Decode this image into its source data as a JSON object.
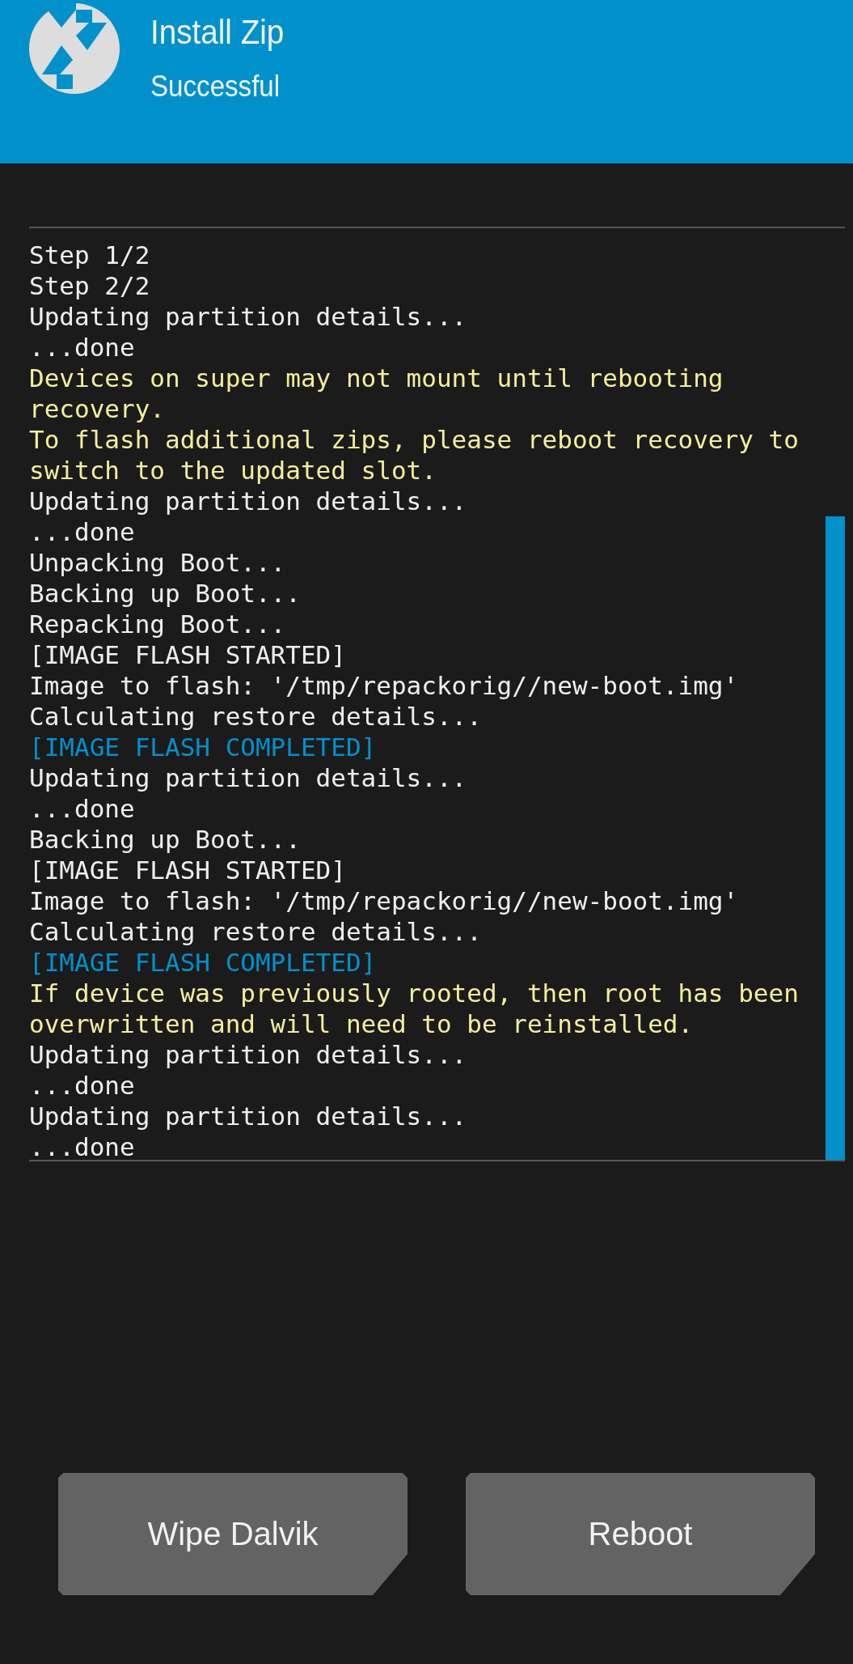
{
  "header": {
    "title": "Install Zip",
    "subtitle": "Successful"
  },
  "log": [
    {
      "kind": "normal",
      "text": "Step 1/2"
    },
    {
      "kind": "normal",
      "text": "Step 2/2"
    },
    {
      "kind": "normal",
      "text": "Updating partition details..."
    },
    {
      "kind": "normal",
      "text": "...done"
    },
    {
      "kind": "warning",
      "text": "Devices on super may not mount until rebooting recovery."
    },
    {
      "kind": "warning",
      "text": "To flash additional zips, please reboot recovery to switch to the updated slot."
    },
    {
      "kind": "normal",
      "text": "Updating partition details..."
    },
    {
      "kind": "normal",
      "text": "...done"
    },
    {
      "kind": "normal",
      "text": "Unpacking Boot..."
    },
    {
      "kind": "normal",
      "text": "Backing up Boot..."
    },
    {
      "kind": "normal",
      "text": "Repacking Boot..."
    },
    {
      "kind": "normal",
      "text": "[IMAGE FLASH STARTED]"
    },
    {
      "kind": "normal",
      "text": "Image to flash: '/tmp/repackorig//new-boot.img'"
    },
    {
      "kind": "normal",
      "text": "Calculating restore details..."
    },
    {
      "kind": "highlight",
      "text": "[IMAGE FLASH COMPLETED]"
    },
    {
      "kind": "normal",
      "text": "Updating partition details..."
    },
    {
      "kind": "normal",
      "text": "...done"
    },
    {
      "kind": "normal",
      "text": "Backing up Boot..."
    },
    {
      "kind": "normal",
      "text": "[IMAGE FLASH STARTED]"
    },
    {
      "kind": "normal",
      "text": "Image to flash: '/tmp/repackorig//new-boot.img'"
    },
    {
      "kind": "normal",
      "text": "Calculating restore details..."
    },
    {
      "kind": "highlight",
      "text": "[IMAGE FLASH COMPLETED]"
    },
    {
      "kind": "warning",
      "text": "If device was previously rooted, then root has been overwritten and will need to be reinstalled."
    },
    {
      "kind": "normal",
      "text": "Updating partition details..."
    },
    {
      "kind": "normal",
      "text": "...done"
    },
    {
      "kind": "normal",
      "text": "Updating partition details..."
    },
    {
      "kind": "normal",
      "text": "...done"
    }
  ],
  "buttons": [
    "Wipe Dalvik",
    "Reboot"
  ]
}
